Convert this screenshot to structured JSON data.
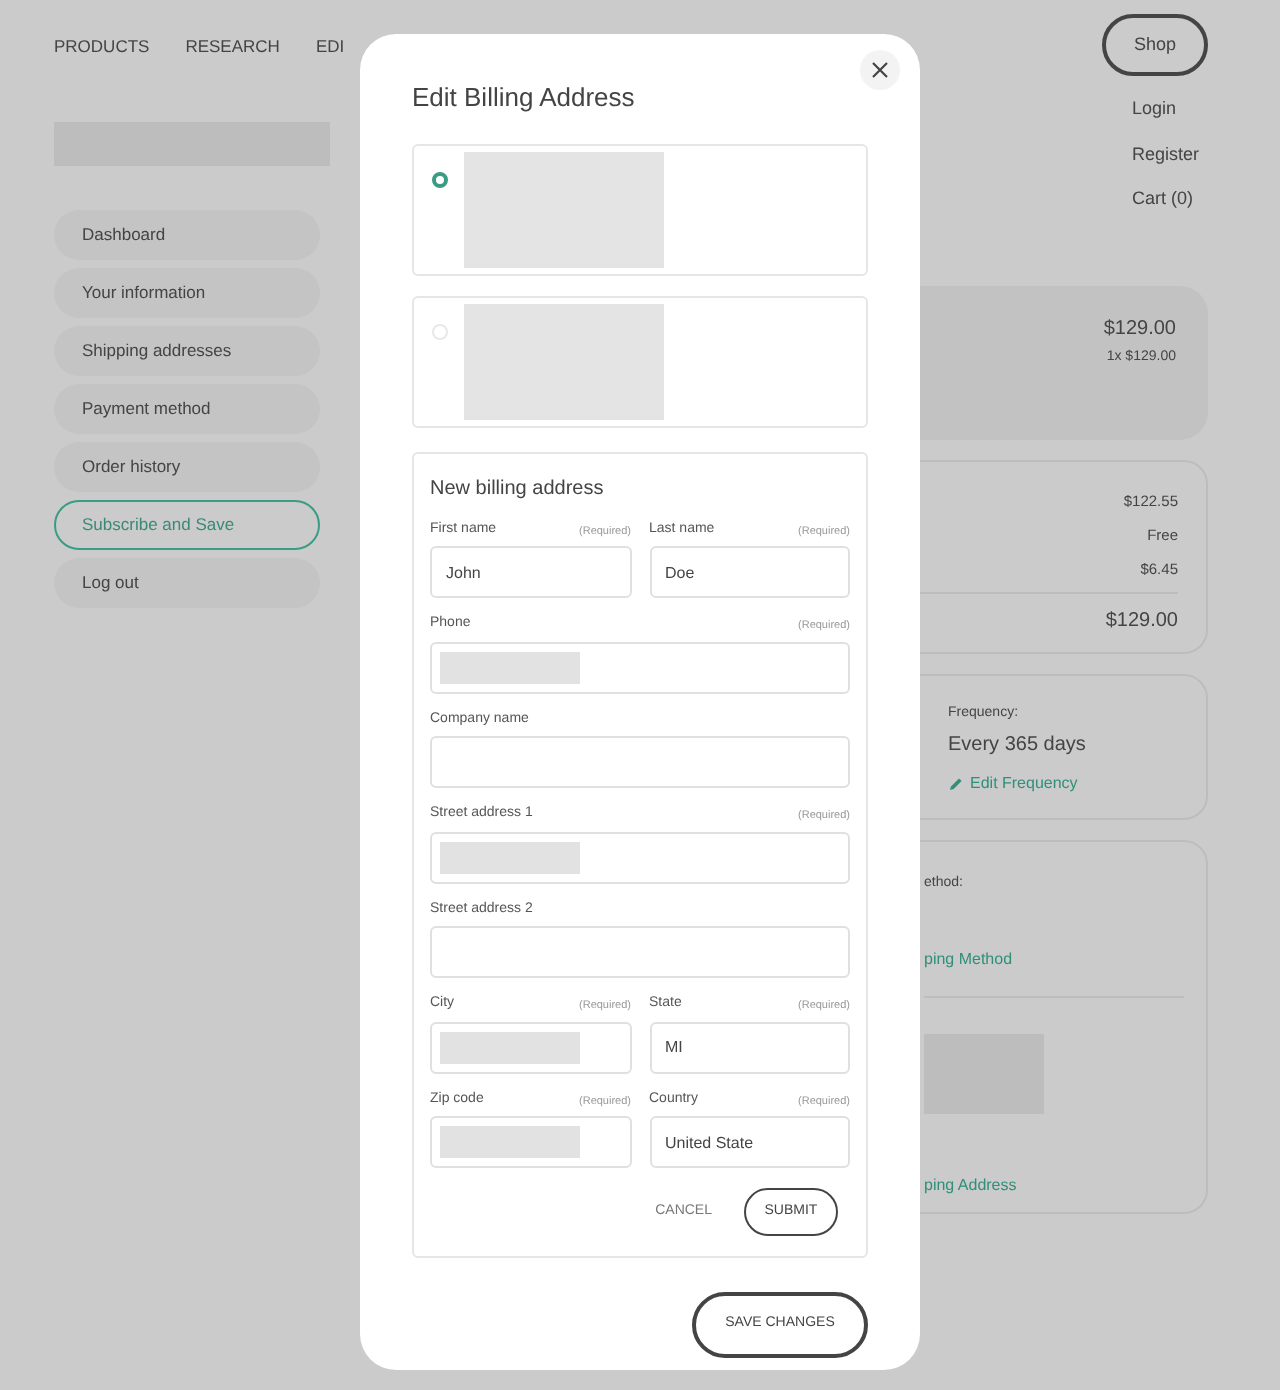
{
  "nav": [
    {
      "label": "PRODUCTS"
    },
    {
      "label": "RESEARCH"
    },
    {
      "label": "EDI"
    }
  ],
  "shop_button": "Shop",
  "account_links": [
    {
      "label": "Login"
    },
    {
      "label": "Register"
    },
    {
      "label": "Cart (0)"
    }
  ],
  "sidebar": {
    "items": [
      {
        "label": "Dashboard",
        "selected": false
      },
      {
        "label": "Your information",
        "selected": false
      },
      {
        "label": "Shipping addresses",
        "selected": false
      },
      {
        "label": "Payment method",
        "selected": false
      },
      {
        "label": "Order history",
        "selected": false
      },
      {
        "label": "Subscribe and Save",
        "selected": true
      },
      {
        "label": "Log out",
        "selected": false
      }
    ]
  },
  "order_summary": {
    "price": "$129.00",
    "quantity_price": "1x $129.00"
  },
  "totals": {
    "lines": [
      "$122.55",
      "Free",
      "$6.45"
    ],
    "total": "$129.00"
  },
  "frequency": {
    "label": "Frequency:",
    "value": "Every 365 days",
    "edit_link": "Edit Frequency"
  },
  "shipping": {
    "method_label": "ethod:",
    "method_link": "ping Method",
    "address_link": "ping Address"
  },
  "modal": {
    "title": "Edit Billing Address",
    "address_options": [
      {
        "selected": true
      },
      {
        "selected": false
      }
    ],
    "new_address": {
      "title": "New billing address",
      "field_rows": [
        [
          {
            "label": "First name",
            "note": "(Required)",
            "kind": "text",
            "value": "John"
          },
          {
            "label": "Last name",
            "note": "(Required)",
            "kind": "text",
            "value": "Doe"
          }
        ],
        [
          {
            "label": "Phone",
            "note": "(Required)",
            "kind": "blurred"
          }
        ],
        [
          {
            "label": "Company name",
            "kind": "empty"
          }
        ],
        [
          {
            "label": "Street address 1",
            "note": "(Required)",
            "kind": "blurred"
          }
        ],
        [
          {
            "label": "Street address 2",
            "kind": "empty"
          }
        ],
        [
          {
            "label": "City",
            "note": "(Required)",
            "kind": "blurred"
          },
          {
            "label": "State",
            "note": "(Required)",
            "kind": "text",
            "value": "MI"
          }
        ],
        [
          {
            "label": "Zip code",
            "note": "(Required)",
            "kind": "blurred"
          },
          {
            "label": "Country",
            "note": "(Required)",
            "kind": "text",
            "value": "United State"
          }
        ]
      ],
      "cancel": "CANCEL",
      "submit": "SUBMIT"
    },
    "save_button": "SAVE CHANGES"
  }
}
